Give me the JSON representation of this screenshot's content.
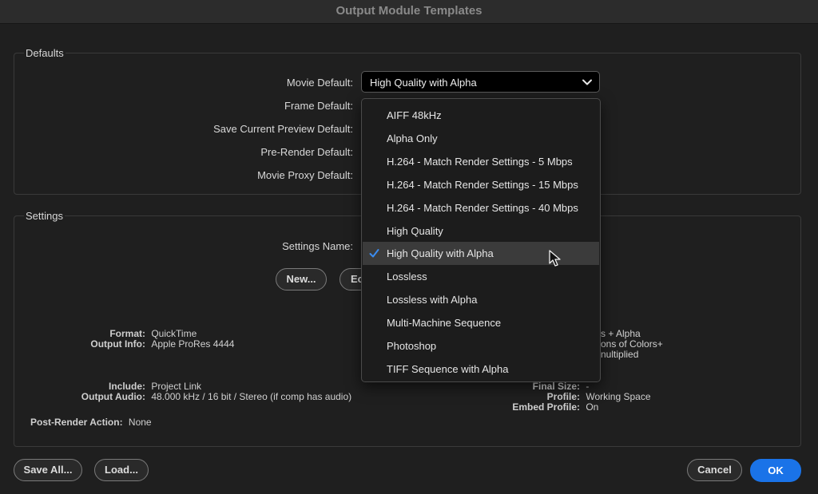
{
  "window": {
    "title": "Output Module Templates"
  },
  "defaults": {
    "group_label": "Defaults",
    "movie_default_label": "Movie Default:",
    "frame_default_label": "Frame Default:",
    "save_preview_label": "Save Current Preview Default:",
    "prerender_label": "Pre-Render Default:",
    "movie_proxy_label": "Movie Proxy Default:",
    "movie_default_value": "High Quality with Alpha"
  },
  "settings": {
    "group_label": "Settings",
    "settings_name_label": "Settings Name:",
    "new_button": "New...",
    "edit_button_partial": "Ec",
    "format_label": "Format:",
    "format_value": "QuickTime",
    "output_info_label": "Output Info:",
    "output_info_value": "Apple ProRes 4444",
    "right_line1": "s + Alpha",
    "right_line2": "ons of Colors+",
    "right_line3": "nultiplied",
    "include_label": "Include:",
    "include_value": "Project Link",
    "output_audio_label": "Output Audio:",
    "output_audio_value": "48.000 kHz / 16 bit / Stereo (if comp has audio)",
    "final_size_label": "Final Size:",
    "final_size_value": "-",
    "profile_label": "Profile:",
    "profile_value": "Working Space",
    "embed_profile_label": "Embed Profile:",
    "embed_profile_value": "On",
    "post_render_label": "Post-Render Action:",
    "post_render_value": "None"
  },
  "dropdown": {
    "items": [
      "AIFF 48kHz",
      "Alpha Only",
      "H.264 - Match Render Settings -  5 Mbps",
      "H.264 - Match Render Settings - 15 Mbps",
      "H.264 - Match Render Settings - 40 Mbps",
      "High Quality",
      "High Quality with Alpha",
      "Lossless",
      "Lossless with Alpha",
      "Multi-Machine Sequence",
      "Photoshop",
      "TIFF Sequence with Alpha"
    ],
    "selected": "High Quality with Alpha"
  },
  "footer": {
    "save_all": "Save All...",
    "load": "Load...",
    "cancel": "Cancel",
    "ok": "OK"
  },
  "colors": {
    "accent": "#1a73e8",
    "checkmark": "#3b8cf0"
  }
}
